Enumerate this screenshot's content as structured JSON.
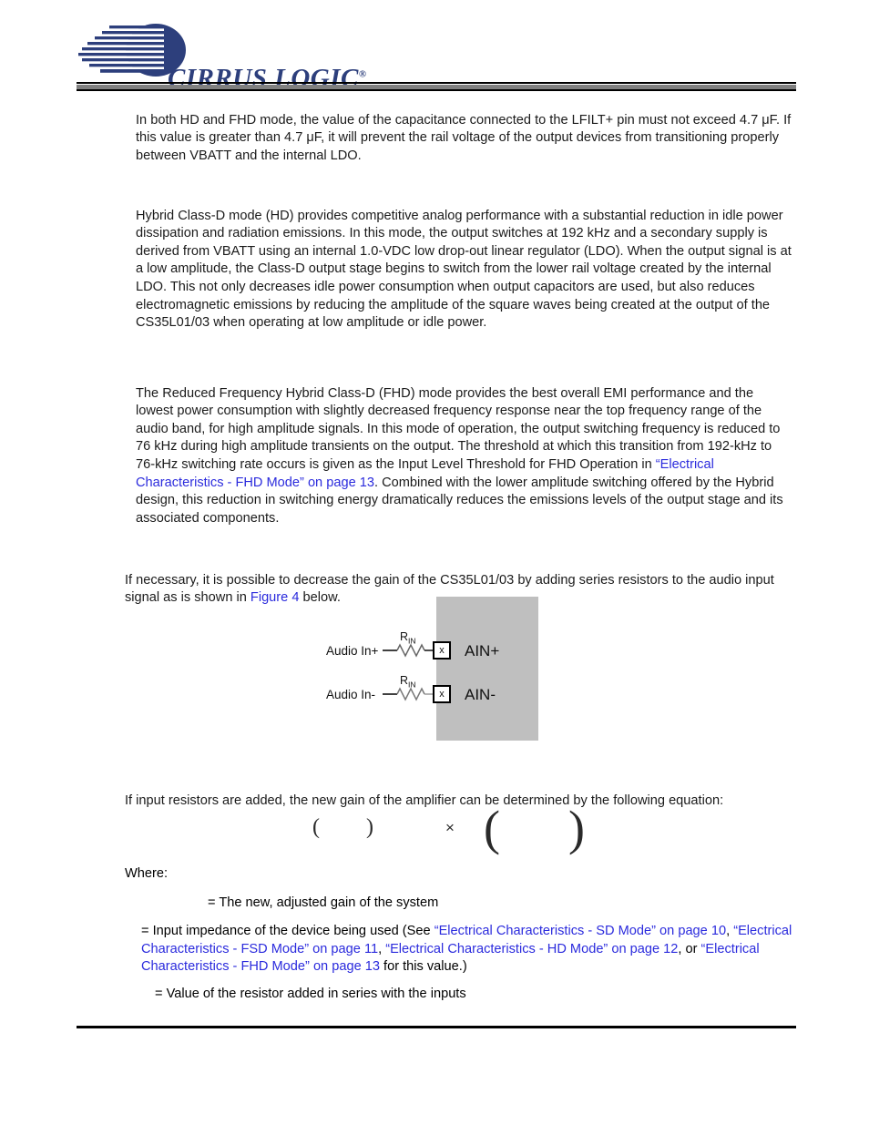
{
  "letterhead": {
    "brand": "CIRRUS LOGIC",
    "registered_mark": "®",
    "logo_icon": "cirrus-logic-swoosh-logo",
    "brand_color": "#2d3f7c"
  },
  "link_color": "#2b2bdd",
  "body": {
    "paragraph_1": "In both HD and FHD mode, the value of the capacitance connected to the LFILT+ pin must not exceed 4.7 μF. If this value is greater than 4.7 μF, it will prevent the rail voltage of the output devices from transitioning properly between VBATT and the internal LDO.",
    "paragraph_2": "Hybrid Class-D mode (HD) provides competitive analog performance with a substantial reduction in idle power dissipation and radiation emissions. In this mode, the output switches at 192 kHz and a secondary supply is derived from VBATT using an internal 1.0-VDC low drop-out linear regulator (LDO). When the output signal is at a low amplitude, the Class-D output stage begins to switch from the lower rail voltage created by the internal LDO. This not only decreases idle power consumption when output capacitors are used, but also reduces electromagnetic emissions by reducing the amplitude of the square waves being created at the output of the CS35L01/03 when operating at low amplitude or idle power.",
    "paragraph_3_part_1": "The Reduced Frequency Hybrid Class-D (FHD) mode provides the best overall EMI performance and the lowest power consumption with slightly decreased frequency response near the top frequency range of the audio band, for high amplitude signals. In this mode of operation, the output switching frequency is reduced to 76 kHz during high amplitude transients on the output. The threshold at which this transition from 192-kHz to 76-kHz switching rate occurs is given as the Input Level Threshold for FHD Operation in ",
    "paragraph_3_link": "“Electrical Characteristics - FHD Mode” on page 13",
    "paragraph_3_part_2": ". Combined with the lower amplitude switching offered by the Hybrid design, this reduction in switching energy dramatically reduces the emissions levels of the output stage and its associated components.",
    "paragraph_4_part_1": "If necessary, it is possible to decrease the gain of the CS35L01/03 by adding series resistors to the audio input signal as is shown in ",
    "paragraph_4_link": "Figure 4",
    "paragraph_4_part_2": " below.",
    "paragraph_5": "If input resistors are added, the new gain of the amplifier can be determined by the following equation:",
    "where_label": "Where:"
  },
  "equation": {
    "open_paren": "(",
    "close_paren": ")",
    "times": "×",
    "big_open_paren": "(",
    "big_close_paren": ")"
  },
  "definitions": {
    "item_1": "= The new, adjusted gain of the system",
    "item_2_part_1": "= Input impedance of the device being used (See ",
    "item_2_link_1": "“Electrical Characteristics - SD Mode” on page 10",
    "item_2_sep_1": ", ",
    "item_2_link_2": "“Electrical Characteristics - FSD Mode” on page 11",
    "item_2_sep_2": ", ",
    "item_2_link_3": "“Electrical Characteristics - HD Mode” on page 12",
    "item_2_sep_3": ", or ",
    "item_2_link_4": "“Electrical Characteristics - FHD Mode” on page 13",
    "item_2_part_2": " for this value.)",
    "item_3": "= Value of the resistor added in series with the inputs"
  },
  "figure": {
    "chip_fill_color": "#bfbfbf",
    "rows": [
      {
        "input_label": "Audio In+",
        "resistor_label": "R",
        "resistor_sub": "IN",
        "pin_label": "x",
        "output_label": "AIN+"
      },
      {
        "input_label": "Audio In-",
        "resistor_label": "R",
        "resistor_sub": "IN",
        "pin_label": "x",
        "output_label": "AIN-"
      }
    ]
  }
}
